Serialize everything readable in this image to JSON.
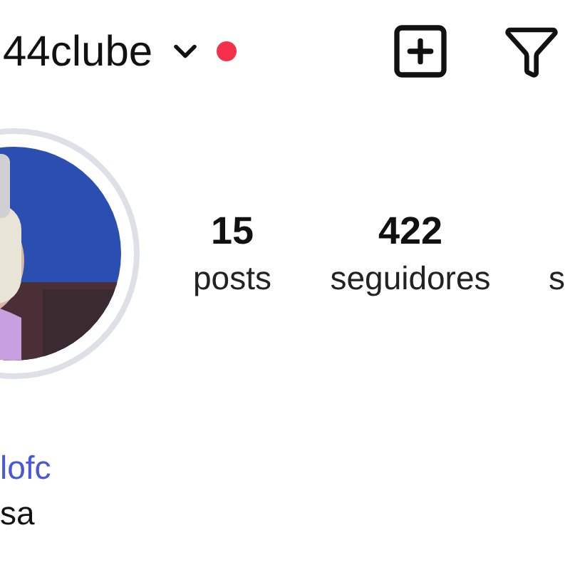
{
  "header": {
    "username": "44clube",
    "notification_dot": true
  },
  "profile": {
    "avatar": {
      "kind": "picture",
      "story_ring": true
    },
    "stats": [
      {
        "count": "15",
        "label": "posts"
      },
      {
        "count": "422",
        "label": "seguidores"
      },
      {
        "label": "s"
      }
    ]
  },
  "bio": {
    "link": "lofc",
    "text": "sa"
  }
}
